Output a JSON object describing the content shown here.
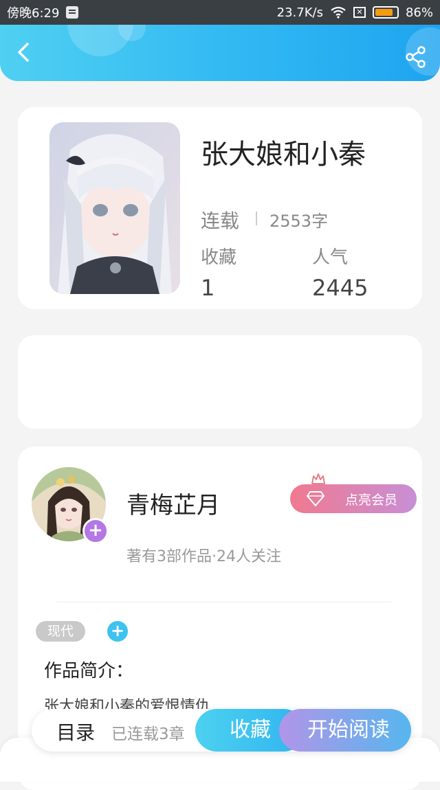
{
  "status_bar": {
    "time": "傍晚6:29",
    "network_speed": "23.7K/s",
    "battery": "86%",
    "battery_level": 0.86
  },
  "header": {
    "back_icon": "chevron-left-icon",
    "share_icon": "share-icon"
  },
  "book": {
    "title": "张大娘和小秦",
    "status": "连载",
    "word_count": "2553字",
    "favorites_label": "收藏",
    "favorites_value": "1",
    "popularity_label": "人气",
    "popularity_value": "2445"
  },
  "author": {
    "name": "青梅芷月",
    "meta": "著有3部作品·24人关注",
    "follow_label": "+",
    "vip_label": "点亮会员"
  },
  "tags": {
    "items": [
      "现代"
    ],
    "add_label": "+"
  },
  "intro": {
    "title": "作品简介：",
    "text": "张大娘和小秦的爱恨情仇"
  },
  "bottom_bar": {
    "toc_label": "目录",
    "chapters_label": "已连载3章",
    "collect_label": "收藏",
    "read_label": "开始阅读"
  },
  "colors": {
    "header_gradient_start": "#4fd0f2",
    "header_gradient_end": "#1ea4f0",
    "vip_gradient_start": "#f0798f",
    "vip_gradient_end": "#c88fd6",
    "follow_plus": "#b477e6",
    "add_tag": "#3ec3f0",
    "battery": "#f39c12"
  }
}
